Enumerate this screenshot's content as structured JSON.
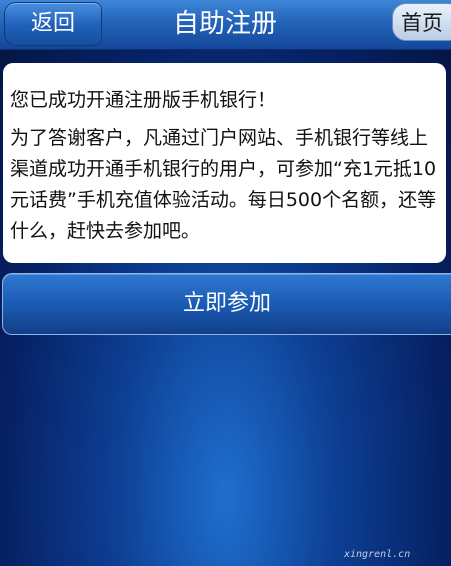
{
  "header": {
    "back_label": "返回",
    "title": "自助注册",
    "home_label": "首页"
  },
  "message": {
    "headline": "您已成功开通注册版手机银行！",
    "body": "为了答谢客户，凡通过门户网站、手机银行等线上渠道成功开通手机银行的用户，可参加“充1元抵10元话费”手机充值体验活动。每日500个名额，还等什么，赶快去参加吧。"
  },
  "actions": {
    "join_label": "立即参加"
  },
  "watermark": "xingrenl.cn",
  "colors": {
    "header_blue": "#2364b9",
    "background_blue": "#0d3f93",
    "card_white": "#ffffff"
  }
}
